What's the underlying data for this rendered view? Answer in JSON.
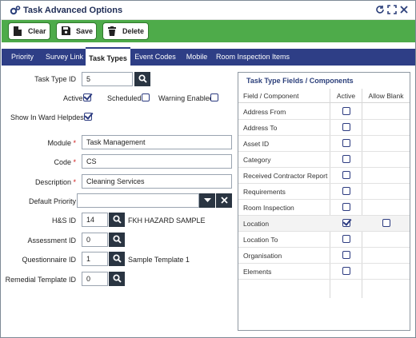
{
  "window": {
    "title": "Task Advanced Options"
  },
  "toolbar": {
    "clear_label": "Clear",
    "save_label": "Save",
    "delete_label": "Delete"
  },
  "tabs": [
    {
      "label": "Priority",
      "active": false
    },
    {
      "label": "Survey Link",
      "active": false
    },
    {
      "label": "Task Types",
      "active": true
    },
    {
      "label": "Event Codes",
      "active": false
    },
    {
      "label": "Mobile",
      "active": false
    },
    {
      "label": "Room Inspection Items",
      "active": false
    }
  ],
  "form": {
    "task_type_id": {
      "label": "Task Type ID",
      "value": "5"
    },
    "active": {
      "label": "Active",
      "checked": true
    },
    "scheduled": {
      "label": "Scheduled",
      "checked": false
    },
    "warning_enabled": {
      "label": "Warning Enabled",
      "checked": false
    },
    "show_in_ward_helpdesk": {
      "label": "Show In Ward Helpdesk",
      "checked": true
    },
    "module": {
      "label": "Module",
      "value": "Task Management"
    },
    "code": {
      "label": "Code",
      "value": "CS"
    },
    "description": {
      "label": "Description",
      "value": "Cleaning Services"
    },
    "default_priority": {
      "label": "Default Priority",
      "value": ""
    },
    "hs_id": {
      "label": "H&S ID",
      "value": "14",
      "text": "FKH HAZARD SAMPLE"
    },
    "assessment_id": {
      "label": "Assessment ID",
      "value": "0"
    },
    "questionnaire_id": {
      "label": "Questionnaire ID",
      "value": "1",
      "text": "Sample Template 1"
    },
    "remedial_template_id": {
      "label": "Remedial Template ID",
      "value": "0"
    },
    "required_mark": "*"
  },
  "fields_panel": {
    "title": "Task Type Fields / Components",
    "headers": {
      "field": "Field / Component",
      "active": "Active",
      "allow_blank": "Allow Blank"
    },
    "rows": [
      {
        "name": "Address From",
        "active": false,
        "allow_blank": null
      },
      {
        "name": "Address To",
        "active": false,
        "allow_blank": null
      },
      {
        "name": "Asset ID",
        "active": false,
        "allow_blank": null
      },
      {
        "name": "Category",
        "active": false,
        "allow_blank": null
      },
      {
        "name": "Received Contractor Report",
        "active": false,
        "allow_blank": null
      },
      {
        "name": "Requirements",
        "active": false,
        "allow_blank": null
      },
      {
        "name": "Room Inspection",
        "active": false,
        "allow_blank": null
      },
      {
        "name": "Location",
        "active": true,
        "allow_blank": false
      },
      {
        "name": "Location To",
        "active": false,
        "allow_blank": null
      },
      {
        "name": "Organisation",
        "active": false,
        "allow_blank": null
      },
      {
        "name": "Elements",
        "active": false,
        "allow_blank": null
      }
    ]
  },
  "icons": {
    "title": "gears-icon",
    "refresh": "refresh-icon",
    "expand": "expand-icon",
    "close": "close-icon",
    "clear": "document-icon",
    "save": "floppy-disk-icon",
    "delete": "trash-icon",
    "search": "search-icon",
    "dropdown": "caret-down-icon",
    "clear_field": "x-icon"
  },
  "colors": {
    "toolbar": "#4eab4a",
    "tabs": "#2e3e86",
    "title": "#1f2d56",
    "required": "#d01c1c"
  }
}
